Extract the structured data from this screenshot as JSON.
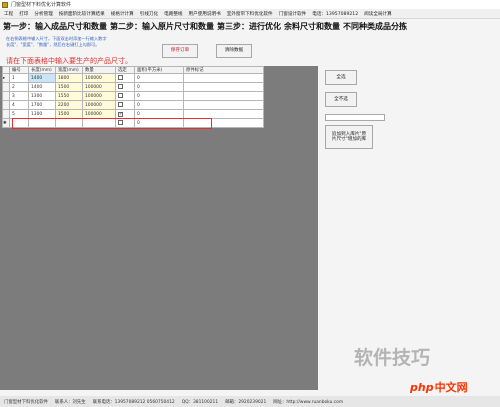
{
  "window": {
    "title": "门窗型材下料优化计算软件"
  },
  "menu": {
    "items": [
      "工程",
      "打印",
      "分析管理",
      "按新面阶比较计算结果",
      "规格计计算",
      "引线刀化",
      "电路整线",
      "用户使用说明书",
      "室外窗帘下料优化软件",
      "门窗设计软件",
      "电话：13957089212",
      "阅读全局计算"
    ]
  },
  "steps": [
    {
      "label": "第一步：输入成品尺寸和数量"
    },
    {
      "label": "第二步：输入原片尺寸和数量"
    },
    {
      "label": "第三步：进行优化"
    },
    {
      "label": "余料尺寸和数量"
    },
    {
      "label": "不同种类成品分拣"
    }
  ],
  "instructions": {
    "line1": "在右侧表格中输入尺寸，下面双击时添加一行输入数字",
    "line2": "长度\"、\"宽度\"、\"数量\"，然后在右键打上勾即可。"
  },
  "buttons": {
    "save_order": "保存订单",
    "clear_data": "清除数据",
    "select_all": "全选",
    "deselect_all": "全不选",
    "apply_to_stock": "追加到入库片\"原\n片尺寸\"增加的库"
  },
  "hint": "请在下面表格中输入要生产的产品尺寸。",
  "table": {
    "columns": [
      "编号",
      "长度(mm)",
      "宽度(mm)",
      "数量",
      "选定",
      "面积(平方米)",
      "原件标记"
    ],
    "rows": [
      {
        "id": "1",
        "length": "1400",
        "width": "1800",
        "qty": "100000",
        "checked": false,
        "area": "0",
        "mark": ""
      },
      {
        "id": "2",
        "length": "1400",
        "width": "1500",
        "qty": "100000",
        "checked": false,
        "area": "0",
        "mark": ""
      },
      {
        "id": "3",
        "length": "1300",
        "width": "1550",
        "qty": "100000",
        "checked": false,
        "area": "0",
        "mark": ""
      },
      {
        "id": "4",
        "length": "1700",
        "width": "2200",
        "qty": "100000",
        "checked": false,
        "area": "0",
        "mark": ""
      },
      {
        "id": "5",
        "length": "1300",
        "width": "1500",
        "qty": "100000",
        "checked": true,
        "area": "0",
        "mark": ""
      },
      {
        "id": "",
        "length": "",
        "width": "",
        "qty": "",
        "checked": false,
        "area": "0",
        "mark": ""
      }
    ]
  },
  "status": {
    "items": [
      "门窗型材下料优化软件",
      "联系人：刘先生",
      "联系电话：13957089212  0560750412",
      "QQ：381100211",
      "邮箱：2920239021",
      "网址：http://www.ruanboku.com"
    ]
  },
  "watermark": {
    "main": "软件技巧",
    "brand_php": "php",
    "brand_cn": "中文网"
  },
  "colors": {
    "accent_red": "#e03030",
    "selected_cell": "#c8e6f8",
    "highlight_yellow": "#fffbd8",
    "dark_area": "#7c7c7c"
  }
}
